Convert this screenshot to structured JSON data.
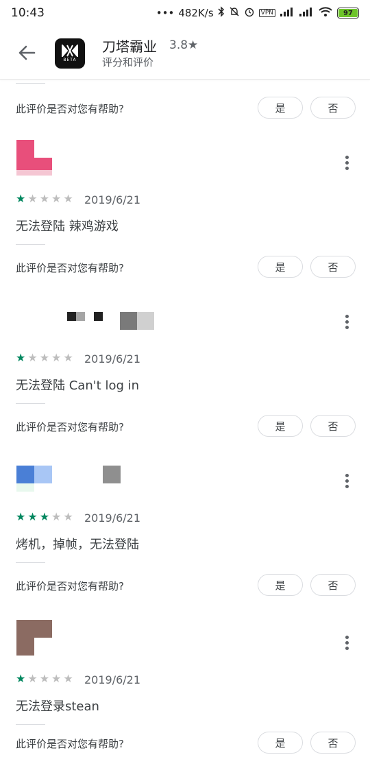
{
  "status_bar": {
    "time": "10:43",
    "network_speed": "482K/s",
    "vpn": "VPN",
    "battery": "97"
  },
  "header": {
    "app_name": "刀塔霸业",
    "rating": "3.8★",
    "subtitle": "评分和评价",
    "icon_badge": "BETA"
  },
  "helpful": {
    "question": "此评价是否对您有帮助?",
    "yes": "是",
    "no": "否"
  },
  "reviews": [
    {
      "stars": 1,
      "date": "2019/6/21",
      "text": "无法登陆 辣鸡游戏",
      "avatar_color": "#e84f7b"
    },
    {
      "stars": 1,
      "date": "2019/6/21",
      "text": "无法登陆 Can't log in",
      "avatar_color": "#222222"
    },
    {
      "stars": 3,
      "date": "2019/6/21",
      "text": "烤机，掉帧，无法登陆",
      "avatar_color": "#4a7fd6"
    },
    {
      "stars": 1,
      "date": "2019/6/21",
      "text": "无法登录stean",
      "avatar_color": "#8b6b62"
    }
  ],
  "colors": {
    "star_on": "#01875f",
    "star_off": "#bdbdbd"
  }
}
